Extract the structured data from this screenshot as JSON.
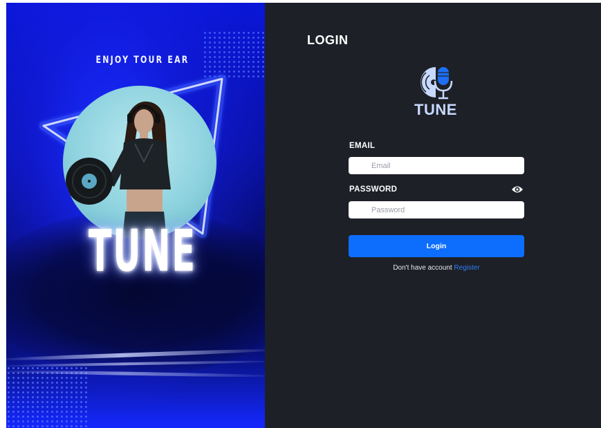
{
  "poster": {
    "tagline": "ENJOY TOUR EAR",
    "brand": "TUNE"
  },
  "login": {
    "heading": "LOGIN",
    "logo_text": "TUNE",
    "email_label": "EMAIL",
    "email_placeholder": "Email",
    "password_label": "PASSWORD",
    "password_placeholder": "Password",
    "submit_label": "Login",
    "no_account_text": "Don't have account",
    "register_link": "Register"
  },
  "colors": {
    "panel_background": "#1d2027",
    "primary_button": "#0d6efd",
    "link": "#2f7cf6",
    "logo_accent": "#c7d9ff"
  },
  "icons": {
    "logo": "vinyl-record-microphone-icon",
    "password_toggle": "eye-icon"
  }
}
